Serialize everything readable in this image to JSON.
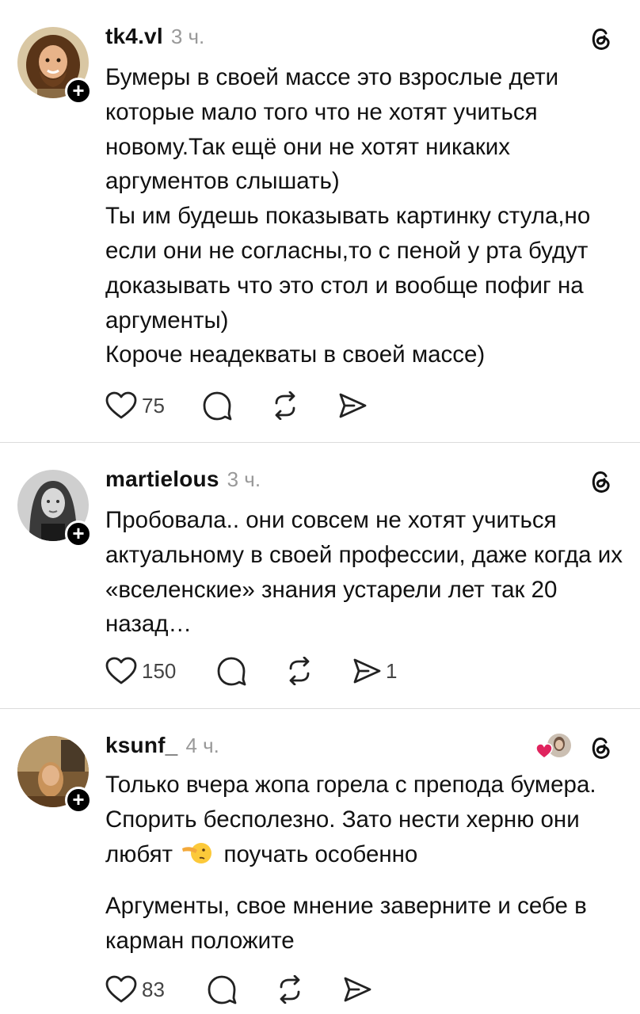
{
  "posts": [
    {
      "username": "tk4.vl",
      "time": "3 ч.",
      "paragraphs": [
        "Бумеры в своей массе это взрослые дети которые мало того что не хотят учиться новому.Так ещё они не хотят никаких аргументов слышать)",
        "Ты им будешь показывать картинку стула,но если они не согласны,то с пеной у рта будут доказывать что это стол и вообще пофиг на аргументы)",
        "Короче неадекваты в своей массе)"
      ],
      "likes": "75",
      "shares": ""
    },
    {
      "username": "martielous",
      "time": "3 ч.",
      "paragraphs": [
        "Пробовала.. они совсем не хотят учиться актуальному в своей профессии, даже когда их «вселенские» знания устарели лет так 20 назад…"
      ],
      "likes": "150",
      "shares": "1"
    },
    {
      "username": "ksunf_",
      "time": "4 ч.",
      "line1": "Только вчера жопа горела с препода бумера. Спорить бесполезно. Зато нести херню они любят",
      "line1_after": "поучать особенно",
      "paragraph2": "Аргументы, свое мнение заверните и себе в карман положите",
      "likes": "83",
      "shares": ""
    }
  ],
  "icons": {
    "like": "heart-icon",
    "comment": "comment-icon",
    "repost": "repost-icon",
    "share": "share-icon",
    "threads": "threads-logo-icon",
    "follow": "plus-icon"
  },
  "colors": {
    "text": "#111111",
    "muted": "#999999",
    "divider": "#dbdbdb",
    "heart": "#e0245e"
  }
}
